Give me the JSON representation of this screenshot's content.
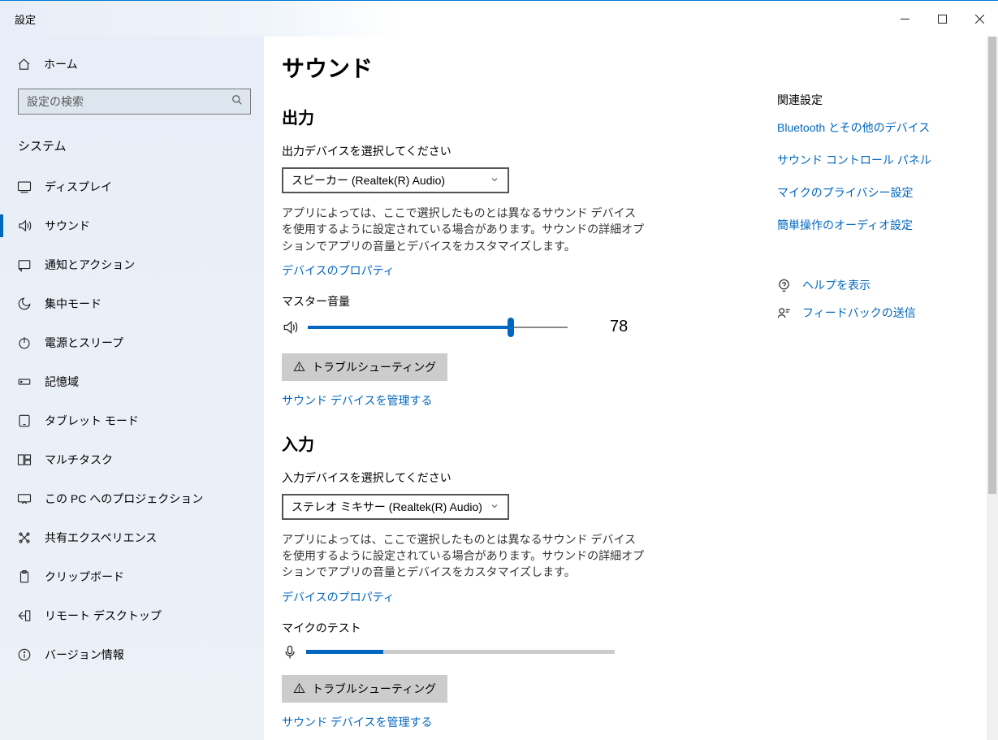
{
  "window": {
    "title": "設定"
  },
  "sidebar": {
    "home": "ホーム",
    "search_placeholder": "設定の検索",
    "section": "システム",
    "items": [
      {
        "label": "ディスプレイ"
      },
      {
        "label": "サウンド"
      },
      {
        "label": "通知とアクション"
      },
      {
        "label": "集中モード"
      },
      {
        "label": "電源とスリープ"
      },
      {
        "label": "記憶域"
      },
      {
        "label": "タブレット モード"
      },
      {
        "label": "マルチタスク"
      },
      {
        "label": "この PC へのプロジェクション"
      },
      {
        "label": "共有エクスペリエンス"
      },
      {
        "label": "クリップボード"
      },
      {
        "label": "リモート デスクトップ"
      },
      {
        "label": "バージョン情報"
      }
    ]
  },
  "page": {
    "title": "サウンド",
    "output": {
      "heading": "出力",
      "select_label": "出力デバイスを選択してください",
      "device": "スピーカー (Realtek(R) Audio)",
      "desc": "アプリによっては、ここで選択したものとは異なるサウンド デバイスを使用するように設定されている場合があります。サウンドの詳細オプションでアプリの音量とデバイスをカスタマイズします。",
      "props_link": "デバイスのプロパティ",
      "master_label": "マスター音量",
      "volume": 78,
      "volume_text": "78",
      "troubleshoot": "トラブルシューティング",
      "manage_link": "サウンド デバイスを管理する"
    },
    "input": {
      "heading": "入力",
      "select_label": "入力デバイスを選択してください",
      "device": "ステレオ ミキサー (Realtek(R) Audio)",
      "desc": "アプリによっては、ここで選択したものとは異なるサウンド デバイスを使用するように設定されている場合があります。サウンドの詳細オプションでアプリの音量とデバイスをカスタマイズします。",
      "props_link": "デバイスのプロパティ",
      "test_label": "マイクのテスト",
      "mic_level": 25,
      "troubleshoot": "トラブルシューティング",
      "manage_link": "サウンド デバイスを管理する"
    }
  },
  "side": {
    "related_heading": "関連設定",
    "links": [
      "Bluetooth とその他のデバイス",
      "サウンド コントロール パネル",
      "マイクのプライバシー設定",
      "簡単操作のオーディオ設定"
    ],
    "help": "ヘルプを表示",
    "feedback": "フィードバックの送信"
  }
}
